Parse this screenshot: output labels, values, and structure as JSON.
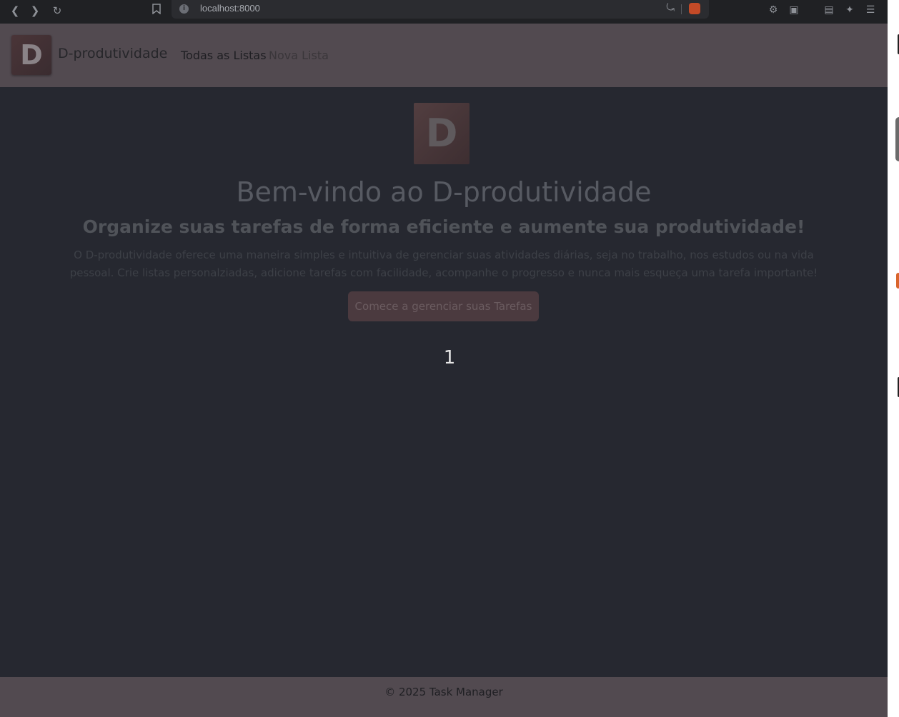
{
  "browser": {
    "url": "localhost:8000",
    "icons": [
      "back-icon",
      "forward-icon",
      "reload-icon",
      "bookmark-icon",
      "site-info-icon",
      "share-icon",
      "brave-shield-icon",
      "extensions-icon",
      "reader-icon",
      "wallet-icon",
      "leo-ai-icon",
      "menu-icon"
    ]
  },
  "header": {
    "logo_letter": "D",
    "brand": "D-produtividade",
    "nav": [
      "Todas as Listas",
      "Nova Lista"
    ]
  },
  "hero": {
    "logo_letter": "D",
    "title": "Bem-vindo ao D-produtividade",
    "subtitle": "Organize suas tarefas de forma eficiente e aumente sua produtividade!",
    "description": "O D-produtividade oferece uma maneira simples e intuitiva de gerenciar suas atividades diárias, seja no trabalho, nos estudos ou na vida pessoal. Crie listas personalziadas, adicione tarefas com facilidade, acompanhe o progresso e nunca mais esqueça uma tarefa importante!",
    "cta_label": "Comece a gerenciar suas Tarefas"
  },
  "overlay_counter": "1",
  "footer": {
    "copyright": "© 2025 Task Manager"
  },
  "colors": {
    "page_bg": "#262830",
    "header_bg": "#524a50",
    "cta_bg": "#4b3a3f"
  }
}
